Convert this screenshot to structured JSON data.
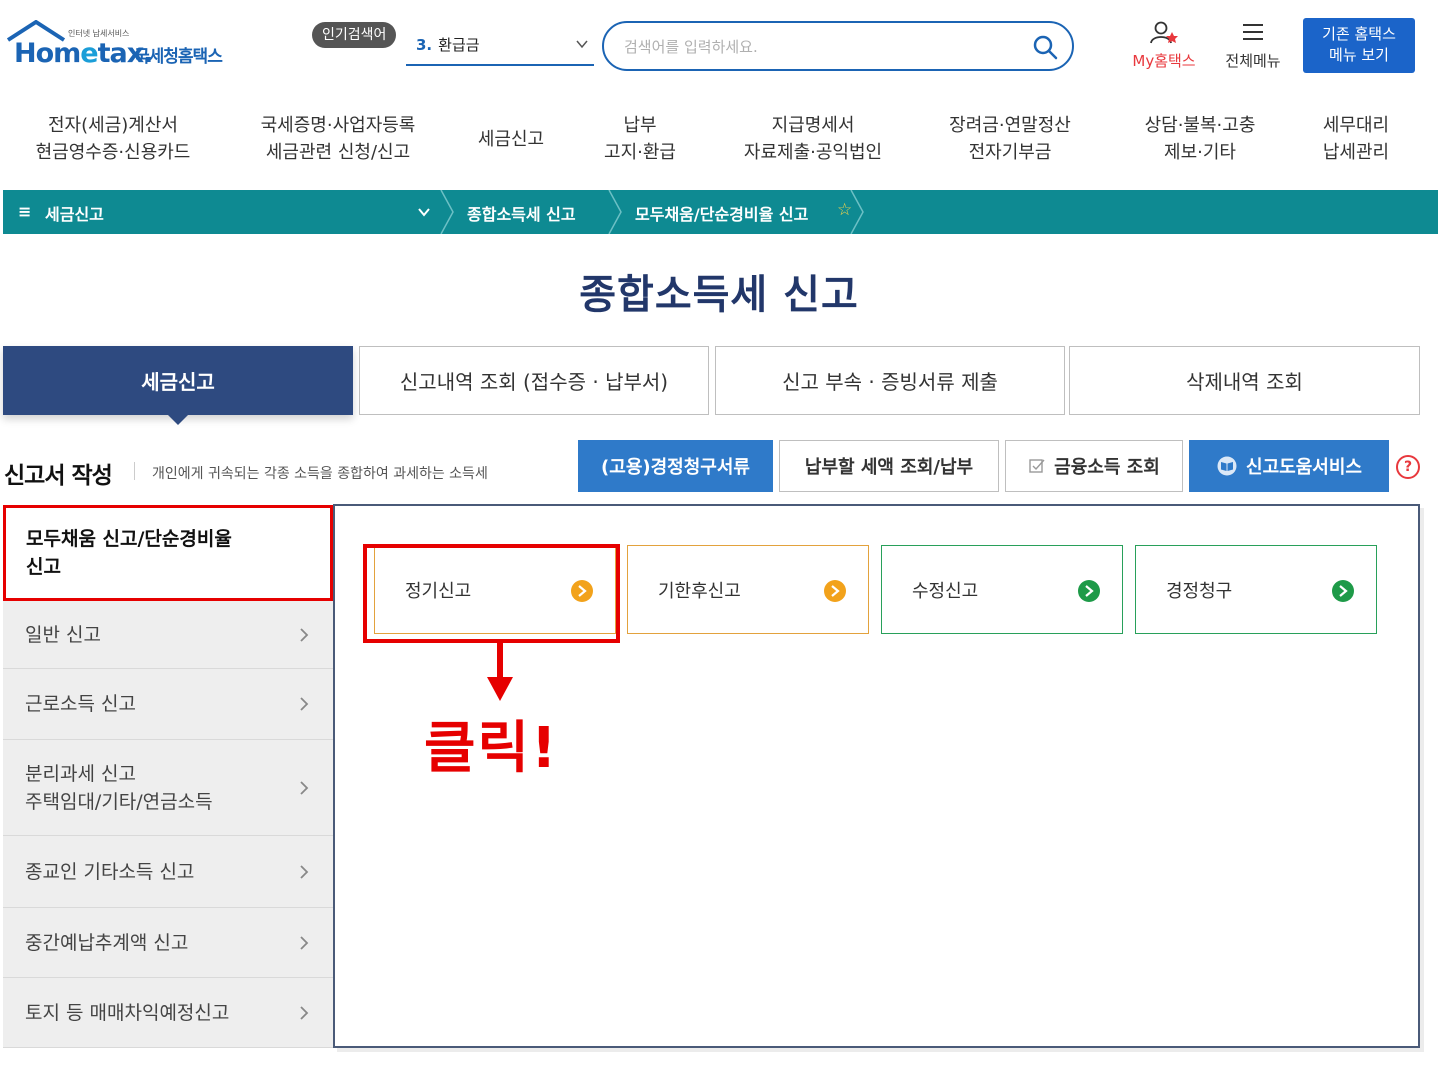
{
  "header": {
    "logo_tagline": "인터넷 납세서비스",
    "logo_brand_a": "Hom",
    "logo_brand_e": "e",
    "logo_brand_b": "tax.",
    "logo_sub": "국세청홈택스",
    "popular_badge": "인기검색어",
    "popular_num": "3.",
    "popular_value": "환급금",
    "search_placeholder": "검색어를 입력하세요.",
    "my_hometax": "My홈택스",
    "all_menu": "전체메뉴",
    "old_menu_button": "기존 홈택스\n메뉴 보기"
  },
  "gnb": [
    "전자(세금)계산서\n현금영수증·신용카드",
    "국세증명·사업자등록\n세금관련 신청/신고",
    "세금신고",
    "납부\n고지·환급",
    "지급명세서\n자료제출·공익법인",
    "장려금·연말정산\n전자기부금",
    "상담·불복·고충\n제보·기타",
    "세무대리\n납세관리"
  ],
  "breadcrumb": {
    "menu_glyph": "≡",
    "level1": "세금신고",
    "level2": "종합소득세 신고",
    "level3": "모두채움/단순경비율 신고",
    "star": "☆"
  },
  "page_title": "종합소득세 신고",
  "tabs": [
    "세금신고",
    "신고내역 조회 (접수증 · 납부서)",
    "신고 부속 · 증빙서류 제출",
    "삭제내역 조회"
  ],
  "section": {
    "title": "신고서 작성",
    "description": "개인에게 귀속되는 각종 소득을 종합하여 과세하는 소득세",
    "actions": [
      "(고용)경정청구서류",
      "납부할 세액 조회/납부",
      "금융소득 조회",
      "신고도움서비스"
    ],
    "help": "?"
  },
  "side_menu": [
    "모두채움 신고/단순경비율\n신고",
    "일반 신고",
    "근로소득 신고",
    "분리과세 신고\n주택임대/기타/연금소득",
    "종교인 기타소득 신고",
    "중간예납추계액 신고",
    "토지 등 매매차익예정신고"
  ],
  "filing_cards": [
    "정기신고",
    "기한후신고",
    "수정신고",
    "경정청구"
  ],
  "annotation": "클릭!",
  "colors": {
    "brand_blue": "#1b64b4",
    "teal_bar": "#0e8a92",
    "active_tab": "#2e4a80",
    "highlight_red": "#e60000",
    "orange_card": "#f2a21b",
    "green_card": "#1e9a48"
  }
}
